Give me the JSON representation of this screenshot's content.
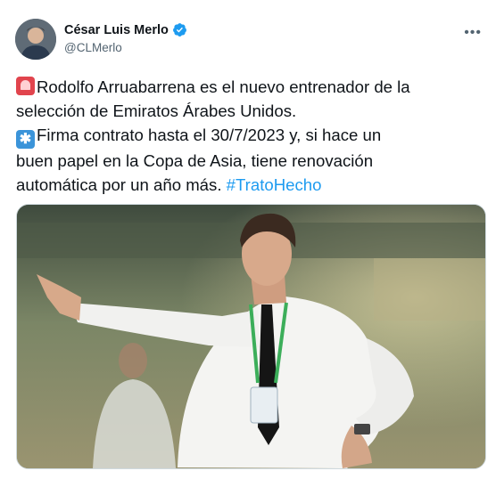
{
  "author": {
    "display_name": "César Luis Merlo",
    "handle": "@CLMerlo",
    "verified_icon": "verified-badge-icon",
    "avatar_icon": "avatar-photo"
  },
  "menu": {
    "more_label": "•••"
  },
  "tweet": {
    "line1_text": "Rodolfo Arruabarrena es el nuevo entrenador de la",
    "line2_text": "selección de Emiratos Árabes Unidos.",
    "line3_text": "Firma contrato hasta el 30/7/2023 y, si hace un",
    "line4_text": "buen papel en la Copa de Asia, tiene renovación",
    "line5_text": "automática por un año más. ",
    "hashtag": "#TratoHecho",
    "emoji_1": "siren-emoji",
    "emoji_2": "sparkle-emoji"
  },
  "media": {
    "photo": "coach-pointing-photo"
  },
  "colors": {
    "link": "#1d9bf0",
    "secondary_text": "#536471",
    "verified": "#1d9bf0"
  }
}
